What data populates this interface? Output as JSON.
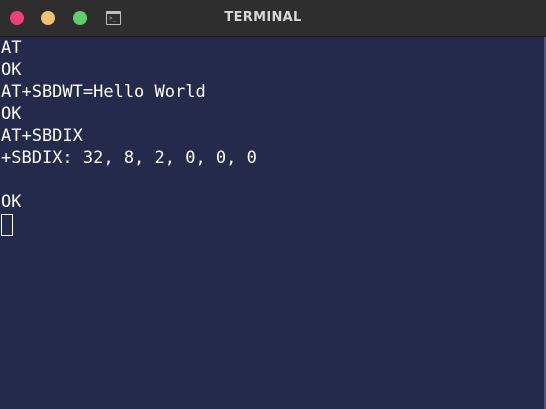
{
  "window": {
    "title": "TERMINAL"
  },
  "icons": {
    "terminal": "terminal-icon"
  },
  "colors": {
    "background": "#242a4b",
    "titlebar": "#2e2e2e",
    "close": "#ef3f7b",
    "minimize": "#f1c26d",
    "maximize": "#5fd16a",
    "text": "#ffffff"
  },
  "terminal": {
    "lines": [
      "AT",
      "OK",
      "AT+SBDWT=Hello World",
      "OK",
      "AT+SBDIX",
      "+SBDIX: 32, 8, 2, 0, 0, 0",
      "",
      "OK"
    ]
  }
}
